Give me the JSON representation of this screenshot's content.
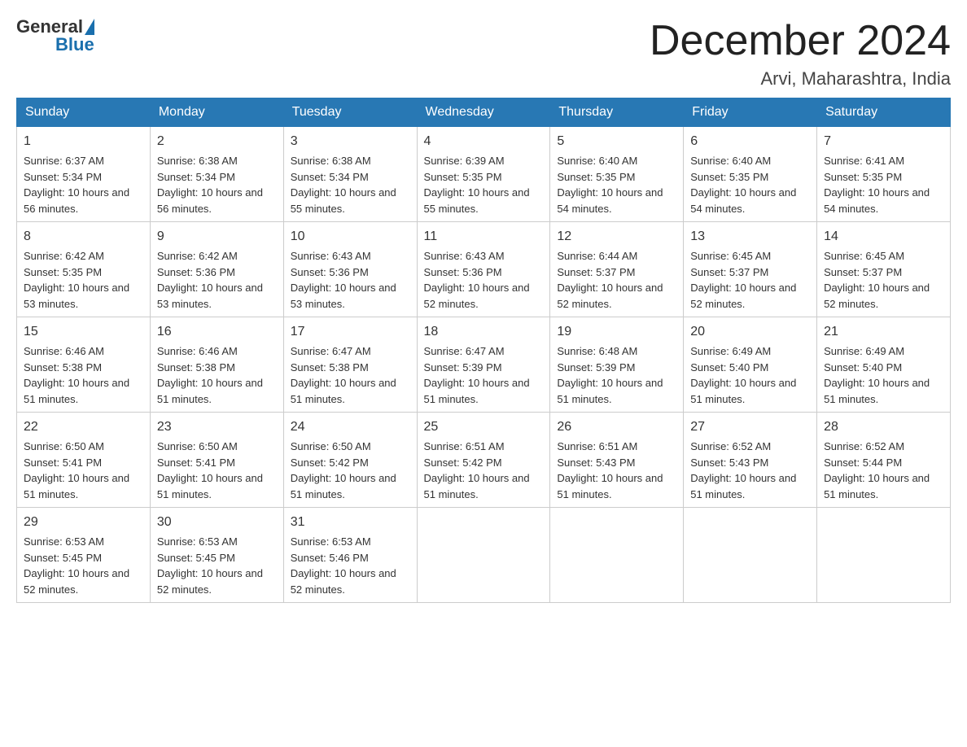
{
  "header": {
    "logo": {
      "part1": "General",
      "part2": "Blue"
    },
    "title": "December 2024",
    "location": "Arvi, Maharashtra, India"
  },
  "weekdays": [
    "Sunday",
    "Monday",
    "Tuesday",
    "Wednesday",
    "Thursday",
    "Friday",
    "Saturday"
  ],
  "weeks": [
    [
      {
        "day": 1,
        "sunrise": "6:37 AM",
        "sunset": "5:34 PM",
        "daylight": "10 hours and 56 minutes."
      },
      {
        "day": 2,
        "sunrise": "6:38 AM",
        "sunset": "5:34 PM",
        "daylight": "10 hours and 56 minutes."
      },
      {
        "day": 3,
        "sunrise": "6:38 AM",
        "sunset": "5:34 PM",
        "daylight": "10 hours and 55 minutes."
      },
      {
        "day": 4,
        "sunrise": "6:39 AM",
        "sunset": "5:35 PM",
        "daylight": "10 hours and 55 minutes."
      },
      {
        "day": 5,
        "sunrise": "6:40 AM",
        "sunset": "5:35 PM",
        "daylight": "10 hours and 54 minutes."
      },
      {
        "day": 6,
        "sunrise": "6:40 AM",
        "sunset": "5:35 PM",
        "daylight": "10 hours and 54 minutes."
      },
      {
        "day": 7,
        "sunrise": "6:41 AM",
        "sunset": "5:35 PM",
        "daylight": "10 hours and 54 minutes."
      }
    ],
    [
      {
        "day": 8,
        "sunrise": "6:42 AM",
        "sunset": "5:35 PM",
        "daylight": "10 hours and 53 minutes."
      },
      {
        "day": 9,
        "sunrise": "6:42 AM",
        "sunset": "5:36 PM",
        "daylight": "10 hours and 53 minutes."
      },
      {
        "day": 10,
        "sunrise": "6:43 AM",
        "sunset": "5:36 PM",
        "daylight": "10 hours and 53 minutes."
      },
      {
        "day": 11,
        "sunrise": "6:43 AM",
        "sunset": "5:36 PM",
        "daylight": "10 hours and 52 minutes."
      },
      {
        "day": 12,
        "sunrise": "6:44 AM",
        "sunset": "5:37 PM",
        "daylight": "10 hours and 52 minutes."
      },
      {
        "day": 13,
        "sunrise": "6:45 AM",
        "sunset": "5:37 PM",
        "daylight": "10 hours and 52 minutes."
      },
      {
        "day": 14,
        "sunrise": "6:45 AM",
        "sunset": "5:37 PM",
        "daylight": "10 hours and 52 minutes."
      }
    ],
    [
      {
        "day": 15,
        "sunrise": "6:46 AM",
        "sunset": "5:38 PM",
        "daylight": "10 hours and 51 minutes."
      },
      {
        "day": 16,
        "sunrise": "6:46 AM",
        "sunset": "5:38 PM",
        "daylight": "10 hours and 51 minutes."
      },
      {
        "day": 17,
        "sunrise": "6:47 AM",
        "sunset": "5:38 PM",
        "daylight": "10 hours and 51 minutes."
      },
      {
        "day": 18,
        "sunrise": "6:47 AM",
        "sunset": "5:39 PM",
        "daylight": "10 hours and 51 minutes."
      },
      {
        "day": 19,
        "sunrise": "6:48 AM",
        "sunset": "5:39 PM",
        "daylight": "10 hours and 51 minutes."
      },
      {
        "day": 20,
        "sunrise": "6:49 AM",
        "sunset": "5:40 PM",
        "daylight": "10 hours and 51 minutes."
      },
      {
        "day": 21,
        "sunrise": "6:49 AM",
        "sunset": "5:40 PM",
        "daylight": "10 hours and 51 minutes."
      }
    ],
    [
      {
        "day": 22,
        "sunrise": "6:50 AM",
        "sunset": "5:41 PM",
        "daylight": "10 hours and 51 minutes."
      },
      {
        "day": 23,
        "sunrise": "6:50 AM",
        "sunset": "5:41 PM",
        "daylight": "10 hours and 51 minutes."
      },
      {
        "day": 24,
        "sunrise": "6:50 AM",
        "sunset": "5:42 PM",
        "daylight": "10 hours and 51 minutes."
      },
      {
        "day": 25,
        "sunrise": "6:51 AM",
        "sunset": "5:42 PM",
        "daylight": "10 hours and 51 minutes."
      },
      {
        "day": 26,
        "sunrise": "6:51 AM",
        "sunset": "5:43 PM",
        "daylight": "10 hours and 51 minutes."
      },
      {
        "day": 27,
        "sunrise": "6:52 AM",
        "sunset": "5:43 PM",
        "daylight": "10 hours and 51 minutes."
      },
      {
        "day": 28,
        "sunrise": "6:52 AM",
        "sunset": "5:44 PM",
        "daylight": "10 hours and 51 minutes."
      }
    ],
    [
      {
        "day": 29,
        "sunrise": "6:53 AM",
        "sunset": "5:45 PM",
        "daylight": "10 hours and 52 minutes."
      },
      {
        "day": 30,
        "sunrise": "6:53 AM",
        "sunset": "5:45 PM",
        "daylight": "10 hours and 52 minutes."
      },
      {
        "day": 31,
        "sunrise": "6:53 AM",
        "sunset": "5:46 PM",
        "daylight": "10 hours and 52 minutes."
      },
      null,
      null,
      null,
      null
    ]
  ]
}
